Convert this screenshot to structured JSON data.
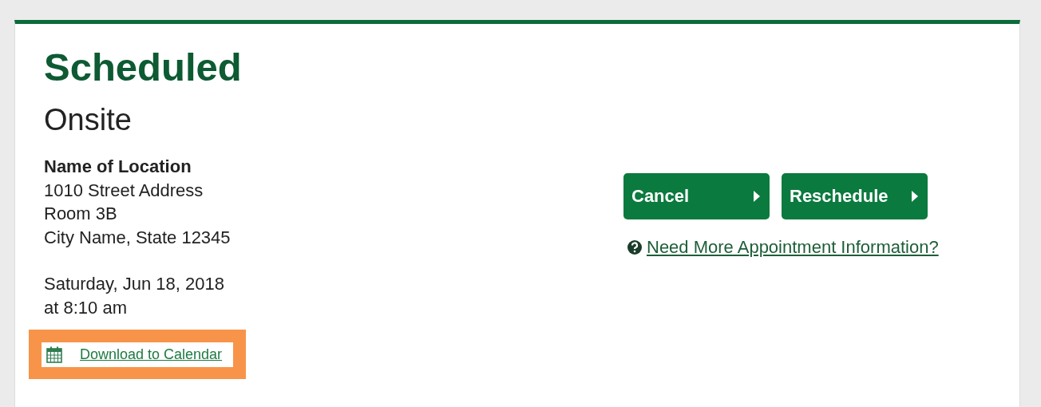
{
  "status": "Scheduled",
  "appointment_type": "Onsite",
  "location": {
    "name": "Name of Location",
    "lines": [
      "1010 Street Address",
      "Room 3B",
      "City Name, State 12345"
    ]
  },
  "datetime": {
    "date": "Saturday, Jun 18, 2018",
    "time": "at 8:10 am"
  },
  "calendar_link": {
    "label": "Download to Calendar",
    "highlighted": true
  },
  "buttons": [
    {
      "label": "Cancel"
    },
    {
      "label": "Reschedule"
    }
  ],
  "help_link": {
    "label": "Need More Appointment Information?"
  }
}
